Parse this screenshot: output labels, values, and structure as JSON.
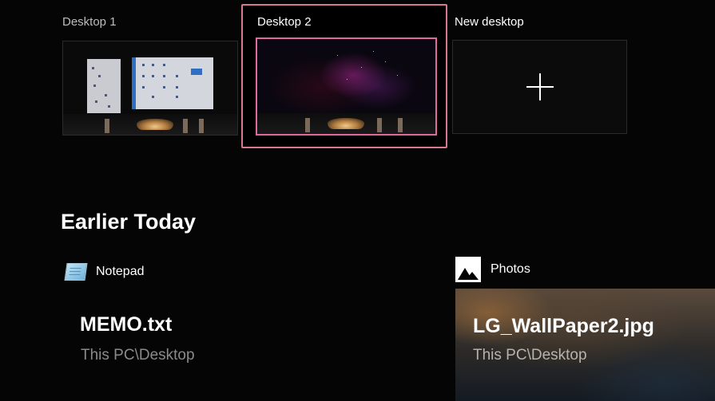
{
  "desktops": [
    {
      "label": "Desktop 1",
      "active": false
    },
    {
      "label": "Desktop 2",
      "active": true
    }
  ],
  "new_desktop": {
    "label": "New desktop",
    "icon": "plus-icon"
  },
  "timeline": {
    "section_title": "Earlier Today",
    "activities": [
      {
        "app": "Notepad",
        "app_icon": "notepad-icon",
        "file": "MEMO.txt",
        "path": "This PC\\Desktop"
      },
      {
        "app": "Photos",
        "app_icon": "photos-icon",
        "file": "LG_WallPaper2.jpg",
        "path": "This PC\\Desktop"
      }
    ]
  },
  "colors": {
    "selection_outer": "#d77a8f",
    "selection_inner": "#e06a9e",
    "background": "#050505"
  }
}
